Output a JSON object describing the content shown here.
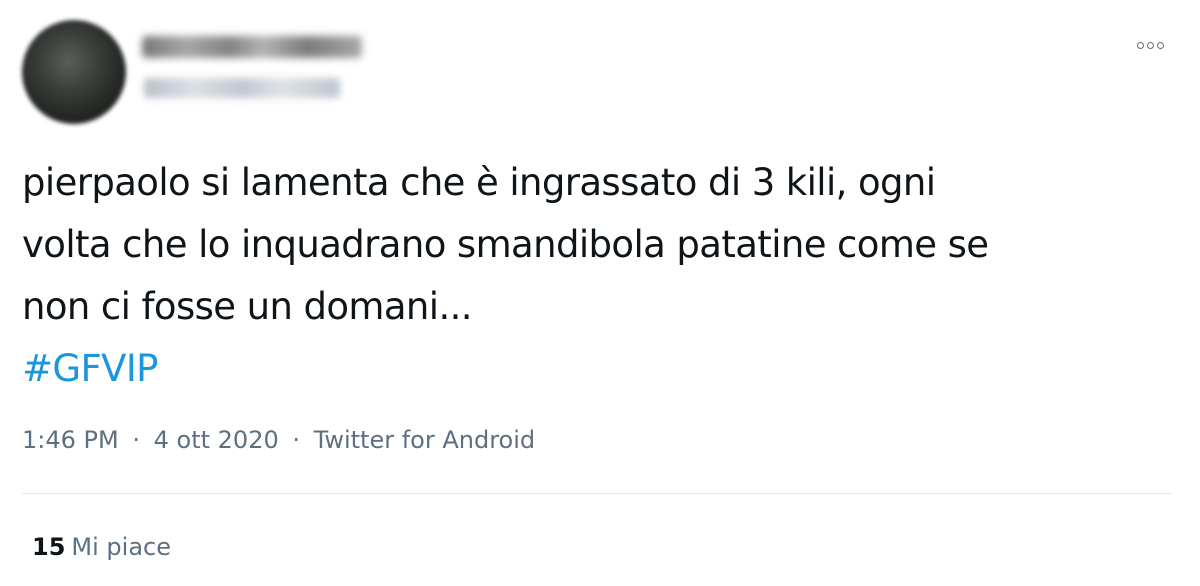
{
  "tweet": {
    "author": {
      "avatar_icon": "blurred-avatar",
      "name": "",
      "handle": ""
    },
    "more_icon": "more-options-icon",
    "text_lines": [
      "pierpaolo si lamenta che è ingrassato di 3 kili, ogni",
      "volta che lo inquadrano smandibola patatine come se",
      "non ci fosse un domani..."
    ],
    "hashtag": "#GFVIP",
    "time": "1:46 PM",
    "date": "4 ott 2020",
    "separator": "·",
    "source": "Twitter for Android",
    "likes_count": "15",
    "likes_label": "Mi piace"
  },
  "colors": {
    "text": "#0f1419",
    "secondary": "#5b7083",
    "link": "#1b95e0",
    "divider": "#e1e8ed"
  }
}
